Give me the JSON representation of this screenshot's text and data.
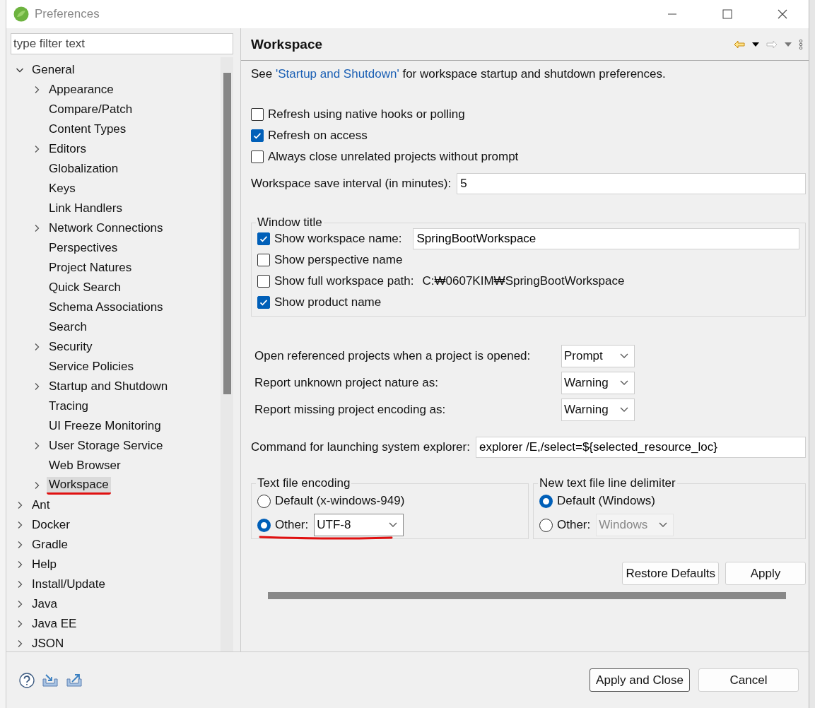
{
  "window": {
    "title": "Preferences"
  },
  "filter": {
    "placeholder": "type filter text"
  },
  "tree": [
    {
      "label": "General",
      "kind": "folder",
      "expanded": true,
      "selected": false,
      "underlined": false,
      "children": [
        {
          "label": "Appearance",
          "kind": "folder",
          "expanded": false,
          "selected": false,
          "underlined": false
        },
        {
          "label": "Compare/Patch",
          "kind": "leaf",
          "selected": false,
          "underlined": false
        },
        {
          "label": "Content Types",
          "kind": "leaf",
          "selected": false,
          "underlined": false
        },
        {
          "label": "Editors",
          "kind": "folder",
          "expanded": false,
          "selected": false,
          "underlined": false
        },
        {
          "label": "Globalization",
          "kind": "leaf",
          "selected": false,
          "underlined": false
        },
        {
          "label": "Keys",
          "kind": "leaf",
          "selected": false,
          "underlined": false
        },
        {
          "label": "Link Handlers",
          "kind": "leaf",
          "selected": false,
          "underlined": false
        },
        {
          "label": "Network Connections",
          "kind": "folder",
          "expanded": false,
          "selected": false,
          "underlined": false
        },
        {
          "label": "Perspectives",
          "kind": "leaf",
          "selected": false,
          "underlined": false
        },
        {
          "label": "Project Natures",
          "kind": "leaf",
          "selected": false,
          "underlined": false
        },
        {
          "label": "Quick Search",
          "kind": "leaf",
          "selected": false,
          "underlined": false
        },
        {
          "label": "Schema Associations",
          "kind": "leaf",
          "selected": false,
          "underlined": false
        },
        {
          "label": "Search",
          "kind": "leaf",
          "selected": false,
          "underlined": false
        },
        {
          "label": "Security",
          "kind": "folder",
          "expanded": false,
          "selected": false,
          "underlined": false
        },
        {
          "label": "Service Policies",
          "kind": "leaf",
          "selected": false,
          "underlined": false
        },
        {
          "label": "Startup and Shutdown",
          "kind": "folder",
          "expanded": false,
          "selected": false,
          "underlined": false
        },
        {
          "label": "Tracing",
          "kind": "leaf",
          "selected": false,
          "underlined": false
        },
        {
          "label": "UI Freeze Monitoring",
          "kind": "leaf",
          "selected": false,
          "underlined": false
        },
        {
          "label": "User Storage Service",
          "kind": "folder",
          "expanded": false,
          "selected": false,
          "underlined": false
        },
        {
          "label": "Web Browser",
          "kind": "leaf",
          "selected": false,
          "underlined": false
        },
        {
          "label": "Workspace",
          "kind": "folder",
          "expanded": false,
          "selected": true,
          "underlined": true
        }
      ]
    },
    {
      "label": "Ant",
      "kind": "folder",
      "expanded": false,
      "selected": false,
      "underlined": false
    },
    {
      "label": "Docker",
      "kind": "folder",
      "expanded": false,
      "selected": false,
      "underlined": false
    },
    {
      "label": "Gradle",
      "kind": "folder",
      "expanded": false,
      "selected": false,
      "underlined": false
    },
    {
      "label": "Help",
      "kind": "folder",
      "expanded": false,
      "selected": false,
      "underlined": false
    },
    {
      "label": "Install/Update",
      "kind": "folder",
      "expanded": false,
      "selected": false,
      "underlined": false
    },
    {
      "label": "Java",
      "kind": "folder",
      "expanded": false,
      "selected": false,
      "underlined": false
    },
    {
      "label": "Java EE",
      "kind": "folder",
      "expanded": false,
      "selected": false,
      "underlined": false
    },
    {
      "label": "JSON",
      "kind": "folder",
      "expanded": false,
      "selected": false,
      "underlined": false
    }
  ],
  "page": {
    "title": "Workspace",
    "intro": {
      "before": "See",
      "link": "'Startup and Shutdown'",
      "after": "for workspace startup and shutdown preferences."
    },
    "options": [
      {
        "label": "Refresh using native hooks or polling",
        "checked": false
      },
      {
        "label": "Refresh on access",
        "checked": true
      },
      {
        "label": "Always close unrelated projects without prompt",
        "checked": false
      }
    ],
    "save_interval": {
      "label": "Workspace save interval (in minutes):",
      "value": "5"
    },
    "window_title": {
      "legend": "Window title",
      "options": [
        {
          "kind": "text",
          "label": "Show workspace name:",
          "checked": true,
          "value": "SpringBootWorkspace"
        },
        {
          "kind": "plain",
          "label": "Show perspective name",
          "checked": false
        },
        {
          "kind": "path",
          "label": "Show full workspace path:",
          "checked": false,
          "value": "C:₩0607KIM₩SpringBootWorkspace"
        },
        {
          "kind": "plain",
          "label": "Show product name",
          "checked": true
        }
      ]
    },
    "dropdowns": [
      {
        "label": "Open referenced projects when a project is opened:",
        "value": "Prompt"
      },
      {
        "label": "Report unknown project nature as:",
        "value": "Warning"
      },
      {
        "label": "Report missing project encoding as:",
        "value": "Warning"
      }
    ],
    "explorer_command": {
      "label": "Command for launching system explorer:",
      "value": "explorer /E,/select=${selected_resource_loc}"
    },
    "encoding": {
      "legend": "Text file encoding",
      "underlined": true,
      "options": [
        {
          "kind": "plain",
          "label": "Default (x-windows-949)",
          "selected": false
        },
        {
          "kind": "combo",
          "label": "Other:",
          "selected": true,
          "value": "UTF-8"
        }
      ]
    },
    "line_delimiter": {
      "legend": "New text file line delimiter",
      "options": [
        {
          "kind": "plain",
          "label": "Default (Windows)",
          "selected": true
        },
        {
          "kind": "combo",
          "label": "Other:",
          "selected": false,
          "value": "Windows"
        }
      ]
    },
    "buttons": [
      "Restore Defaults",
      "Apply"
    ]
  },
  "footer_buttons": [
    {
      "label": "Apply and Close",
      "default": true
    },
    {
      "label": "Cancel",
      "default": false
    }
  ]
}
